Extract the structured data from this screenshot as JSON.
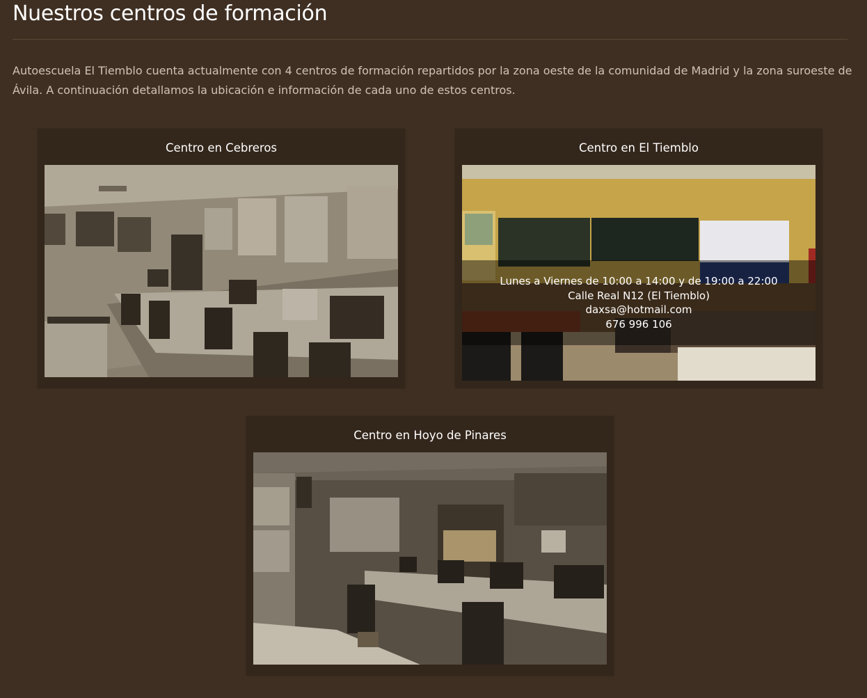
{
  "header": {
    "title": "Nuestros centros de formación"
  },
  "intro": {
    "text": "Autoescuela El Tiemblo cuenta actualmente con 4 centros de formación repartidos por la zona oeste de la comunidad de Madrid y la zona suroeste de Ávila. A continuación detallamos la ubicación e información de cada uno de estos centros."
  },
  "centers": [
    {
      "title": "Centro en Cebreros",
      "photo": "classroom-photo-sepia"
    },
    {
      "title": "Centro en El Tiemblo",
      "photo": "classroom-photo-color",
      "info": {
        "hours": "Lunes a Viernes de 10:00 a 14:00 y de 19:00 a 22:00",
        "address": "Calle Real N12 (El Tiemblo)",
        "email": "daxsa@hotmail.com",
        "phone": "676 996 106"
      }
    },
    {
      "title": "Centro en Hoyo de Pinares",
      "photo": "classroom-photo-sepia"
    }
  ]
}
